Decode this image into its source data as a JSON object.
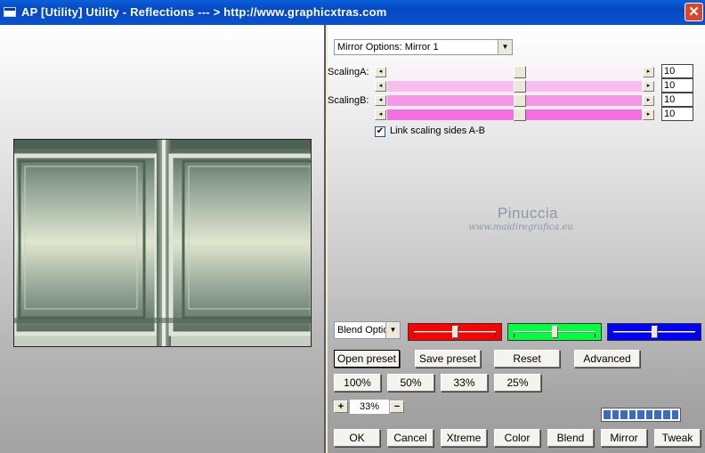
{
  "window": {
    "title": "AP [Utility]  Utility - Reflections     --- > http://www.graphicxtras.com",
    "close_glyph": "✕"
  },
  "mirror_options": {
    "selected": "Mirror Options: Mirror 1"
  },
  "scaling": {
    "a_label": "ScalingA:",
    "b_label": "ScalingB:",
    "sliders": [
      {
        "value": "10",
        "position": 0.52,
        "color": "#fbf1f9"
      },
      {
        "value": "10",
        "position": 0.52,
        "color": "#f8bfee"
      },
      {
        "value": "10",
        "position": 0.52,
        "color": "#f696e6"
      },
      {
        "value": "10",
        "position": 0.52,
        "color": "#f46ee2"
      }
    ]
  },
  "link_scaling": {
    "label": "Link scaling sides A-B",
    "checked": true,
    "check_glyph": "✔"
  },
  "watermark": {
    "name": "Pinuccia",
    "url": "www.maidiregrafica.eu"
  },
  "blend_options": {
    "selected": "Blend Optio"
  },
  "color_channels": [
    {
      "name": "red",
      "color": "#ff0000",
      "position": 0.5
    },
    {
      "name": "green",
      "color": "#00ff3c",
      "position": 0.5
    },
    {
      "name": "blue",
      "color": "#0000ff",
      "position": 0.5
    }
  ],
  "preset_buttons": {
    "open": "Open preset",
    "save": "Save preset",
    "reset": "Reset",
    "advanced": "Advanced"
  },
  "zoom_buttons": [
    "100%",
    "50%",
    "33%",
    "25%"
  ],
  "zoom": {
    "value": "33%",
    "plus": "+",
    "minus": "−"
  },
  "progress": {
    "segments": 9
  },
  "bottom_buttons": {
    "ok": "OK",
    "cancel": "Cancel",
    "xtreme": "Xtreme",
    "color": "Color",
    "blend": "Blend",
    "mirror": "Mirror",
    "tweak": "Tweak"
  },
  "arrows": {
    "left": "◂",
    "right": "▸",
    "down": "▼"
  }
}
